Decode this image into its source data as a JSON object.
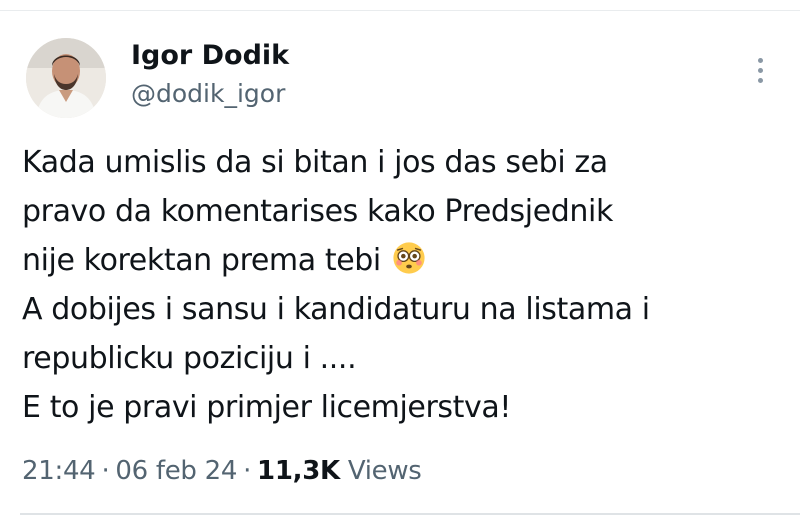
{
  "tweet": {
    "author": {
      "display_name": "Igor Dodik",
      "handle": "@dodik_igor"
    },
    "more_icon": "more-vertical-icon",
    "body_lines": [
      "Kada umislis da si bitan i jos das sebi za",
      "pravo da komentarises kako Predsjednik",
      "nije korektan prema tebi",
      "A dobijes i sansu i kandidaturu na listama i",
      "republicku poziciju i ....",
      "E to je pravi primjer licemjerstva!"
    ],
    "emoji": "flushed-face-emoji",
    "time": "21:44",
    "date": "06 feb 24",
    "separator": "·",
    "views_count": "11,3K",
    "views_label": "Views"
  }
}
